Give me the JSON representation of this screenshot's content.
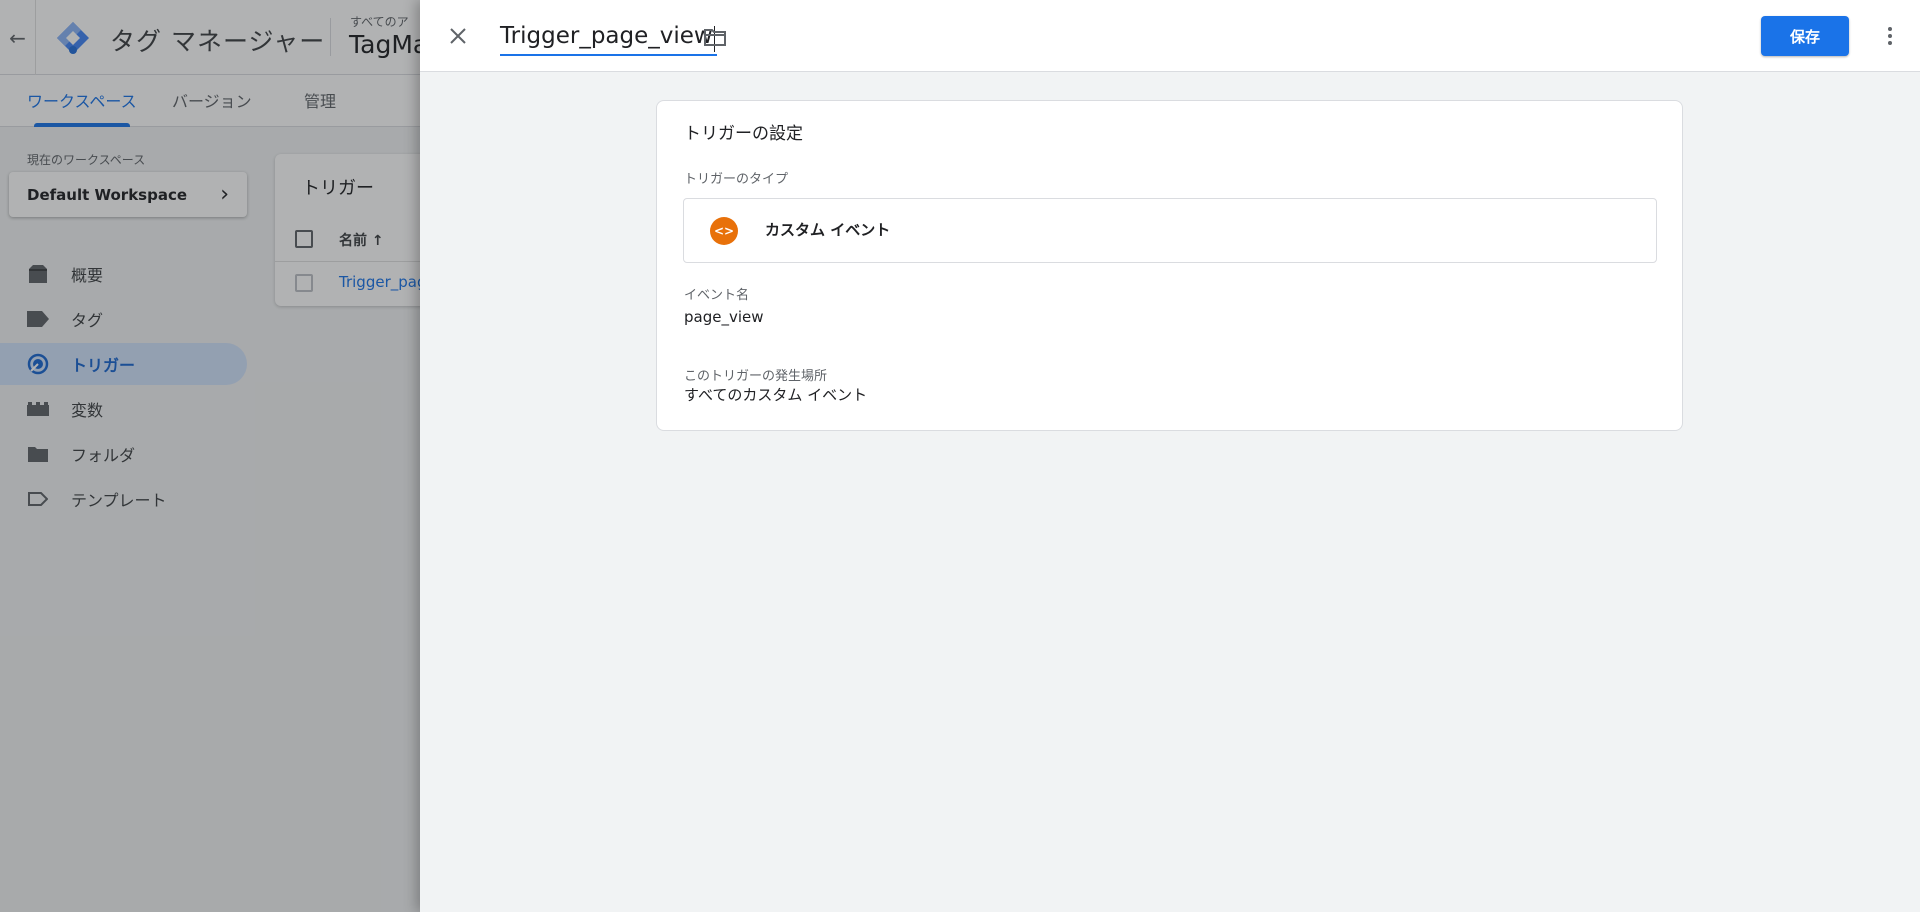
{
  "header": {
    "app_title": "タグ マネージャー",
    "account_small": "すべてのア",
    "account_name": "TagMa"
  },
  "tabs": [
    {
      "label": "ワークスペース",
      "active": true
    },
    {
      "label": "バージョン",
      "active": false
    },
    {
      "label": "管理",
      "active": false
    }
  ],
  "workspace": {
    "label": "現在のワークスペース",
    "name": "Default Workspace"
  },
  "nav": {
    "items": [
      {
        "label": "概要",
        "icon": "overview-icon"
      },
      {
        "label": "タグ",
        "icon": "tag-icon"
      },
      {
        "label": "トリガー",
        "icon": "trigger-icon",
        "active": true
      },
      {
        "label": "変数",
        "icon": "variables-icon"
      },
      {
        "label": "フォルダ",
        "icon": "folder-icon"
      },
      {
        "label": "テンプレート",
        "icon": "template-icon"
      }
    ]
  },
  "list": {
    "title": "トリガー",
    "column_name": "名前 ↑",
    "row_link": "Trigger_pag"
  },
  "panel": {
    "name_value": "Trigger_page_view",
    "save_label": "保存",
    "card": {
      "title": "トリガーの設定",
      "type_label": "トリガーのタイプ",
      "type_name": "カスタム イベント",
      "event_label": "イベント名",
      "event_value": "page_view",
      "fires_label": "このトリガーの発生場所",
      "fires_value": "すべてのカスタム イベント"
    }
  },
  "colors": {
    "accent": "#1a73e8",
    "custom_event_icon": "#e8710a",
    "nav_active_bg": "#d2e3fc"
  }
}
